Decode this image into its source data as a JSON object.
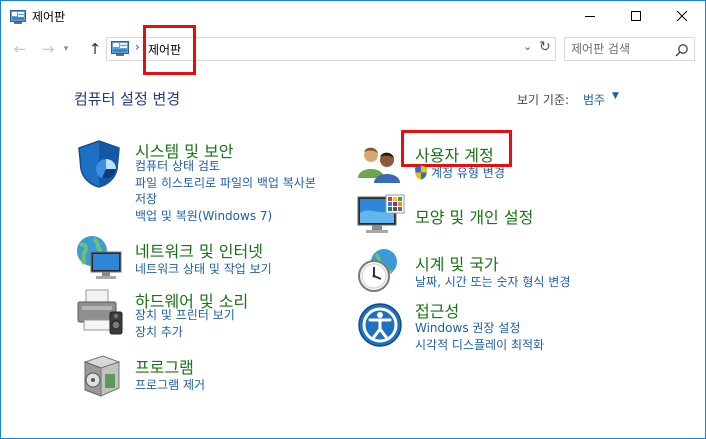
{
  "window": {
    "title": "제어판",
    "minimize_label": "—",
    "maximize_label": "□",
    "close_label": "✕"
  },
  "nav": {
    "back_glyph": "←",
    "forward_glyph": "→",
    "recent_glyph": "▾",
    "up_glyph": "↑",
    "breadcrumb_separator": "›",
    "address": "제어판",
    "address_dropdown_glyph": "⌄",
    "refresh_glyph": "↻",
    "search_placeholder": "제어판 검색"
  },
  "header": {
    "title": "컴퓨터 설정 변경",
    "view_by_label": "보기 기준:",
    "view_by_value": "범주",
    "view_by_caret": "▼"
  },
  "categories": {
    "system": {
      "title": "시스템 및 보안",
      "links": [
        "컴퓨터 상태 검토",
        "파일 히스토리로 파일의 백업 복사본",
        "저장",
        "백업 및 복원(Windows 7)"
      ]
    },
    "network": {
      "title": "네트워크 및 인터넷",
      "links": [
        "네트워크 상태 및 작업 보기"
      ]
    },
    "hardware": {
      "title": "하드웨어 및 소리",
      "links": [
        "장치 및 프린터 보기",
        "장치 추가"
      ]
    },
    "programs": {
      "title": "프로그램",
      "links": [
        "프로그램 제거"
      ]
    },
    "user": {
      "title": "사용자 계정",
      "links": [
        "계정 유형 변경"
      ]
    },
    "appearance": {
      "title": "모양 및 개인 설정",
      "links": []
    },
    "clock": {
      "title": "시계 및 국가",
      "links": [
        "날짜, 시간 또는 숫자 형식 변경"
      ]
    },
    "ease": {
      "title": "접근성",
      "links": [
        "Windows 권장 설정",
        "시각적 디스플레이 최적화"
      ]
    }
  },
  "colors": {
    "accent_border": "#1883d7",
    "category_title": "#1a7316",
    "link": "#1f5fa8",
    "highlight": "#e60f0f"
  },
  "icons": {
    "app": "control-panel-icon",
    "system": "shield-icon",
    "network": "network-globe-icon",
    "hardware": "printer-speaker-icon",
    "programs": "program-box-icon",
    "user": "users-icon",
    "appearance": "monitor-palette-icon",
    "clock": "clock-globe-icon",
    "ease": "accessibility-icon"
  }
}
